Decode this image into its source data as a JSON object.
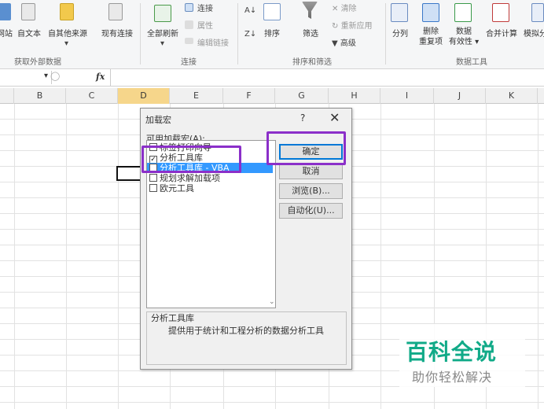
{
  "ribbon": {
    "get_external": {
      "buttons": [
        "自网站",
        "自文本",
        "自其他来源",
        "现有连接"
      ],
      "label": "获取外部数据"
    },
    "connections": {
      "refresh_all": "全部刷新",
      "links": [
        "连接",
        "属性",
        "编辑链接"
      ],
      "label": "连接"
    },
    "sort_filter": {
      "sort": "排序",
      "filter": "筛选",
      "clear": "清除",
      "reapply": "重新应用",
      "advanced": "高级",
      "label": "排序和筛选"
    },
    "data_tools": {
      "split": "分列",
      "remove_dup_1": "删除",
      "remove_dup_2": "重复项",
      "validation_1": "数据",
      "validation_2": "有效性",
      "consolidate": "合并计算",
      "whatif": "模拟分",
      "label": "数据工具"
    }
  },
  "formula_bar": {
    "fx": "fx"
  },
  "columns": [
    "B",
    "C",
    "D",
    "E",
    "F",
    "G",
    "H",
    "I",
    "J",
    "K"
  ],
  "dialog": {
    "title": "加载宏",
    "help": "?",
    "close": "✕",
    "available_label": "可用加载宏(A):",
    "addins": [
      {
        "label": "标签打印向导",
        "checked": false
      },
      {
        "label": "分析工具库",
        "checked": true
      },
      {
        "label": "分析工具库 - VBA",
        "checked": false
      },
      {
        "label": "规划求解加载项",
        "checked": false
      },
      {
        "label": "欧元工具",
        "checked": false
      }
    ],
    "buttons": {
      "ok": "确定",
      "cancel": "取消",
      "browse": "浏览(B)...",
      "automation": "自动化(U)..."
    },
    "desc_title": "分析工具库",
    "desc_text": "提供用于统计和工程分析的数据分析工具"
  },
  "watermark": {
    "line1": "百科全说",
    "line2": "助你轻松解决"
  },
  "colors": {
    "highlight": "#8b2fc9",
    "selection": "#3399ff",
    "col_selected": "#f6d68b"
  }
}
